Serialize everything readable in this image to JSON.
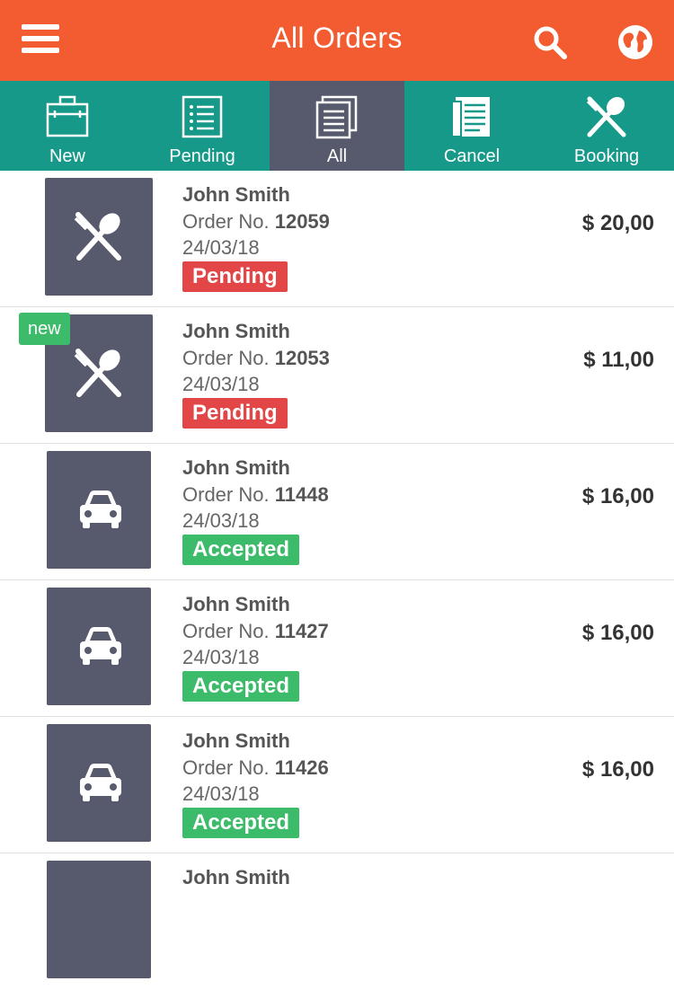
{
  "header": {
    "title": "All Orders",
    "menu_icon": "hamburger-menu-icon",
    "search_icon": "search-icon",
    "globe_icon": "globe-icon",
    "background": "#f25c30"
  },
  "tabs": [
    {
      "label": "New",
      "icon": "briefcase-icon",
      "active": false
    },
    {
      "label": "Pending",
      "icon": "list-icon",
      "active": false
    },
    {
      "label": "All",
      "icon": "documents-icon",
      "active": true
    },
    {
      "label": "Cancel",
      "icon": "receipt-icon",
      "active": false
    },
    {
      "label": "Booking",
      "icon": "fork-spoon-icon",
      "active": false
    }
  ],
  "orders": [
    {
      "name": "John Smith",
      "order_prefix": "Order No.",
      "order_no": "12059",
      "date": "24/03/18",
      "status": "Pending",
      "price": "$ 20,00",
      "icon": "fork-spoon-icon",
      "new": false
    },
    {
      "name": "John Smith",
      "order_prefix": "Order No.",
      "order_no": "12053",
      "date": "24/03/18",
      "status": "Pending",
      "price": "$ 11,00",
      "icon": "fork-spoon-icon",
      "new": true,
      "new_label": "new"
    },
    {
      "name": "John Smith",
      "order_prefix": "Order No.",
      "order_no": "11448",
      "date": "24/03/18",
      "status": "Accepted",
      "price": "$ 16,00",
      "icon": "car-icon",
      "new": false
    },
    {
      "name": "John Smith",
      "order_prefix": "Order No.",
      "order_no": "11427",
      "date": "24/03/18",
      "status": "Accepted",
      "price": "$ 16,00",
      "icon": "car-icon",
      "new": false
    },
    {
      "name": "John Smith",
      "order_prefix": "Order No.",
      "order_no": "11426",
      "date": "24/03/18",
      "status": "Accepted",
      "price": "$ 16,00",
      "icon": "car-icon",
      "new": false
    },
    {
      "name": "John Smith",
      "order_prefix": "",
      "order_no": "",
      "date": "",
      "status": "",
      "price": "",
      "icon": "car-icon",
      "new": false
    }
  ],
  "colors": {
    "tab_bar": "#17998a",
    "active_tab": "#575a6d",
    "pending": "#e24646",
    "accepted": "#3cbb6a"
  }
}
